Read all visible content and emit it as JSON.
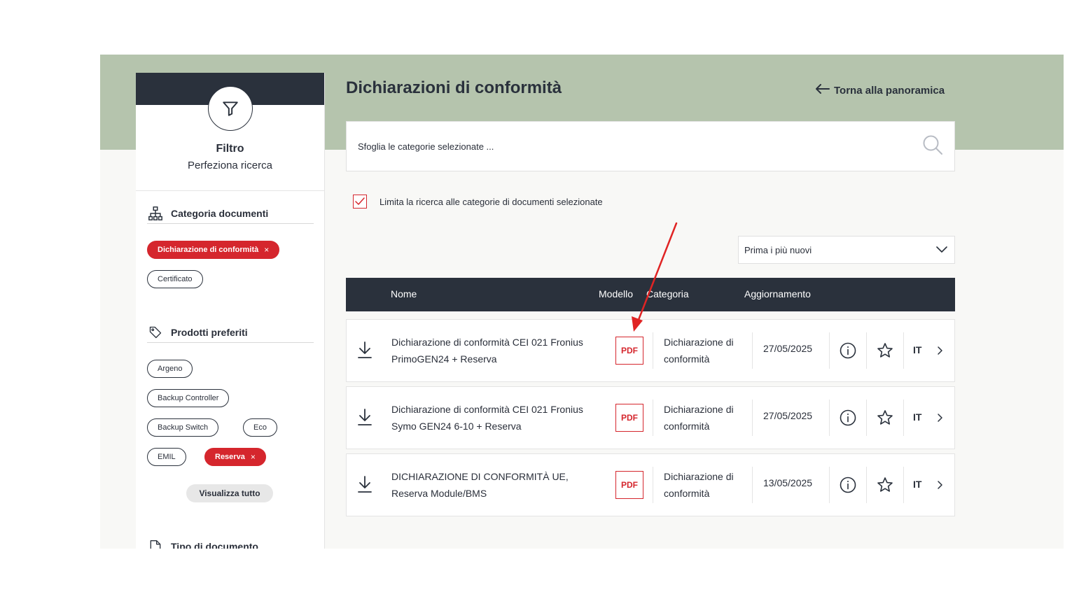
{
  "sidebar": {
    "title": "Filtro",
    "subtitle": "Perfeziona ricerca",
    "sections": {
      "categoria": {
        "title": "Categoria documenti",
        "chips": [
          {
            "label": "Dichiarazione di conformità",
            "active": true
          },
          {
            "label": "Certificato",
            "active": false
          }
        ]
      },
      "prodotti": {
        "title": "Prodotti preferiti",
        "chips": [
          {
            "label": "Argeno",
            "active": false
          },
          {
            "label": "Backup Controller",
            "active": false
          },
          {
            "label": "Backup Switch",
            "active": false
          },
          {
            "label": "Eco",
            "active": false
          },
          {
            "label": "EMIL",
            "active": false
          },
          {
            "label": "Reserva",
            "active": true
          }
        ],
        "see_all": "Visualizza tutto"
      },
      "tipo": {
        "title": "Tipo di documento"
      }
    },
    "chip_remove": "×"
  },
  "main": {
    "title": "Dichiarazioni di conformità",
    "back_link": "Torna alla panoramica",
    "search_placeholder": "Sfoglia le categorie selezionate ...",
    "checkbox_label": "Limita la ricerca alle categorie di documenti selezionate",
    "checkbox_checked": true,
    "sort_value": "Prima i più nuovi",
    "columns": {
      "nome": "Nome",
      "modello": "Modello",
      "categoria": "Categoria",
      "aggiornamento": "Aggiornamento"
    },
    "rows": [
      {
        "name_line1": "Dichiarazione di conformità CEI 021 Fronius",
        "name_line2": "PrimoGEN24 + Reserva",
        "model": "PDF",
        "cat_line1": "Dichiarazione di",
        "cat_line2": "conformità",
        "date": "27/05/2025",
        "lang": "IT"
      },
      {
        "name_line1": "Dichiarazione di conformità CEI 021 Fronius",
        "name_line2": "Symo GEN24 6-10 + Reserva",
        "model": "PDF",
        "cat_line1": "Dichiarazione di",
        "cat_line2": "conformità",
        "date": "27/05/2025",
        "lang": "IT"
      },
      {
        "name_line1": "DICHIARAZIONE DI CONFORMITÀ UE,",
        "name_line2": "Reserva Module/BMS",
        "model": "PDF",
        "cat_line1": "Dichiarazione di",
        "cat_line2": "conformità",
        "date": "13/05/2025",
        "lang": "IT"
      }
    ]
  },
  "colors": {
    "accent_red": "#d5262d",
    "header_dark": "#2a313c",
    "hero_green": "#b5c4ad"
  },
  "icons": [
    "filter-icon",
    "hierarchy-icon",
    "tag-icon",
    "document-icon",
    "arrow-left-icon",
    "search-icon",
    "check-icon",
    "chevron-down-icon",
    "download-icon",
    "info-icon",
    "star-icon",
    "chevron-right-icon",
    "annotation-arrow"
  ]
}
